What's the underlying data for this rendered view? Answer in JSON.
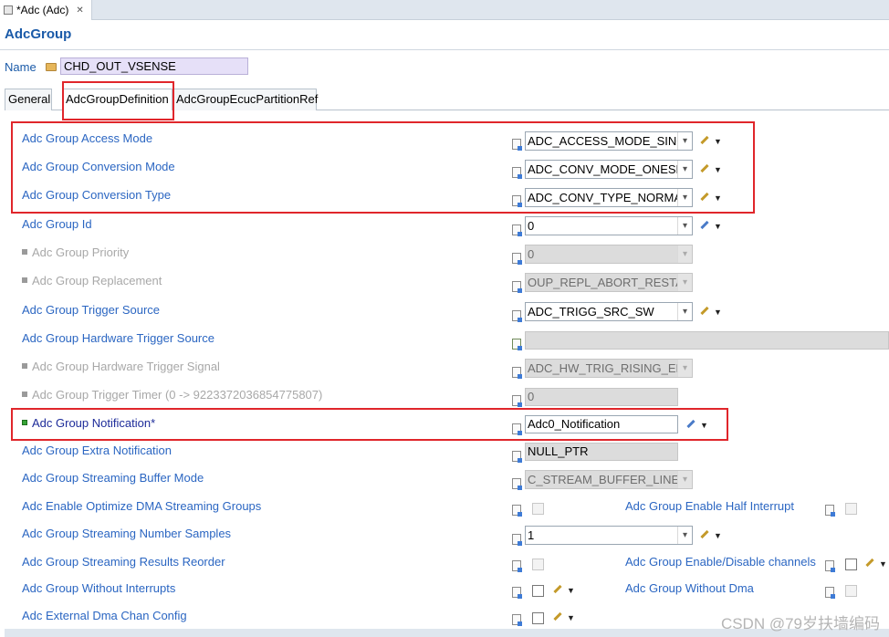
{
  "editor": {
    "tab_title": "*Adc (Adc)",
    "close_glyph": "✕"
  },
  "page_title": "AdcGroup",
  "name": {
    "label": "Name",
    "value": "CHD_OUT_VSENSE"
  },
  "tabs": [
    {
      "label": "General"
    },
    {
      "label": "AdcGroupDefinition"
    },
    {
      "label": "AdcGroupEcucPartitionRef"
    }
  ],
  "rows": [
    {
      "label": "Adc Group Access Mode",
      "value": "ADC_ACCESS_MODE_SINGLE"
    },
    {
      "label": "Adc Group Conversion Mode",
      "value": "ADC_CONV_MODE_ONESHOT"
    },
    {
      "label": "Adc Group Conversion Type",
      "value": "ADC_CONV_TYPE_NORMAL"
    },
    {
      "label": "Adc Group Id",
      "value": "0"
    },
    {
      "label": "Adc Group Priority",
      "value": "0"
    },
    {
      "label": "Adc Group Replacement",
      "value": "OUP_REPL_ABORT_RESTART"
    },
    {
      "label": "Adc Group Trigger Source",
      "value": "ADC_TRIGG_SRC_SW"
    },
    {
      "label": "Adc Group Hardware Trigger Source",
      "value": ""
    },
    {
      "label": "Adc Group Hardware Trigger Signal",
      "value": "ADC_HW_TRIG_RISING_EDGE"
    },
    {
      "label": "Adc Group Trigger Timer (0 -> 9223372036854775807)",
      "value": "0"
    },
    {
      "label": "Adc Group Notification*",
      "value": "Adc0_Notification"
    },
    {
      "label": "Adc Group Extra Notification",
      "value": "NULL_PTR"
    },
    {
      "label": "Adc Group Streaming Buffer Mode",
      "value": "C_STREAM_BUFFER_LINEAR"
    },
    {
      "label": "Adc Enable Optimize DMA Streaming Groups",
      "value": ""
    },
    {
      "label": "Adc Group Streaming Number Samples",
      "value": "1"
    },
    {
      "label": "Adc Group Streaming Results Reorder",
      "value": ""
    },
    {
      "label": "Adc Group Without Interrupts",
      "value": ""
    },
    {
      "label": "Adc External Dma Chan Config",
      "value": ""
    }
  ],
  "right_rows": [
    {
      "label": "Adc Group Enable Half Interrupt"
    },
    {
      "label": "Adc Group Enable/Disable channels"
    },
    {
      "label": "Adc Group Without Dma"
    }
  ],
  "watermark": "CSDN @79岁扶墙编码",
  "colors": {
    "label_blue": "#2b66c2",
    "highlight_red": "#e0262b",
    "title_blue": "#1a5aa8"
  }
}
